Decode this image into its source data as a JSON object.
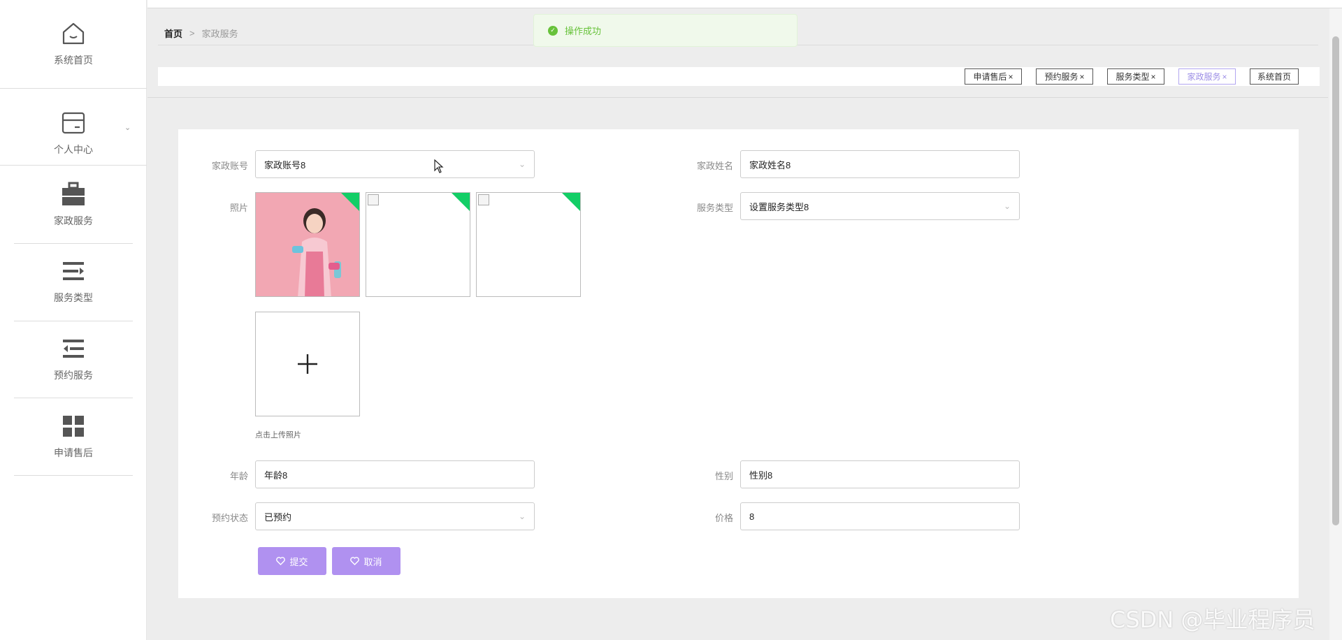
{
  "sidebar": {
    "items": [
      {
        "label": "系统首页",
        "icon": "home-icon"
      },
      {
        "label": "个人中心",
        "icon": "wallet-icon"
      },
      {
        "label": "家政服务",
        "icon": "briefcase-icon"
      },
      {
        "label": "服务类型",
        "icon": "list-arrow-icon"
      },
      {
        "label": "预约服务",
        "icon": "list-indent-icon"
      },
      {
        "label": "申请售后",
        "icon": "grid-icon"
      }
    ]
  },
  "breadcrumb": {
    "home": "首页",
    "separator": ">",
    "current": "家政服务"
  },
  "toast": {
    "message": "操作成功",
    "color": "#67c23a"
  },
  "tags": [
    {
      "label": "申请售后",
      "close": "×"
    },
    {
      "label": "预约服务",
      "close": "×"
    },
    {
      "label": "服务类型",
      "close": "×"
    },
    {
      "label": "家政服务",
      "close": "×",
      "active": true
    },
    {
      "label": "系统首页"
    }
  ],
  "form": {
    "account": {
      "label": "家政账号",
      "value": "家政账号8"
    },
    "name": {
      "label": "家政姓名",
      "value": "家政姓名8"
    },
    "photo": {
      "label": "照片",
      "hint": "点击上传照片"
    },
    "service_type": {
      "label": "服务类型",
      "value": "设置服务类型8"
    },
    "age": {
      "label": "年龄",
      "value": "年龄8"
    },
    "gender": {
      "label": "性别",
      "value": "性别8"
    },
    "status": {
      "label": "预约状态",
      "value": "已预约"
    },
    "price": {
      "label": "价格",
      "value": "8"
    }
  },
  "buttons": {
    "submit": "提交",
    "cancel": "取消"
  },
  "colors": {
    "accent": "#b091f0",
    "success": "#13ce66"
  },
  "watermark": "CSDN @毕业程序员"
}
